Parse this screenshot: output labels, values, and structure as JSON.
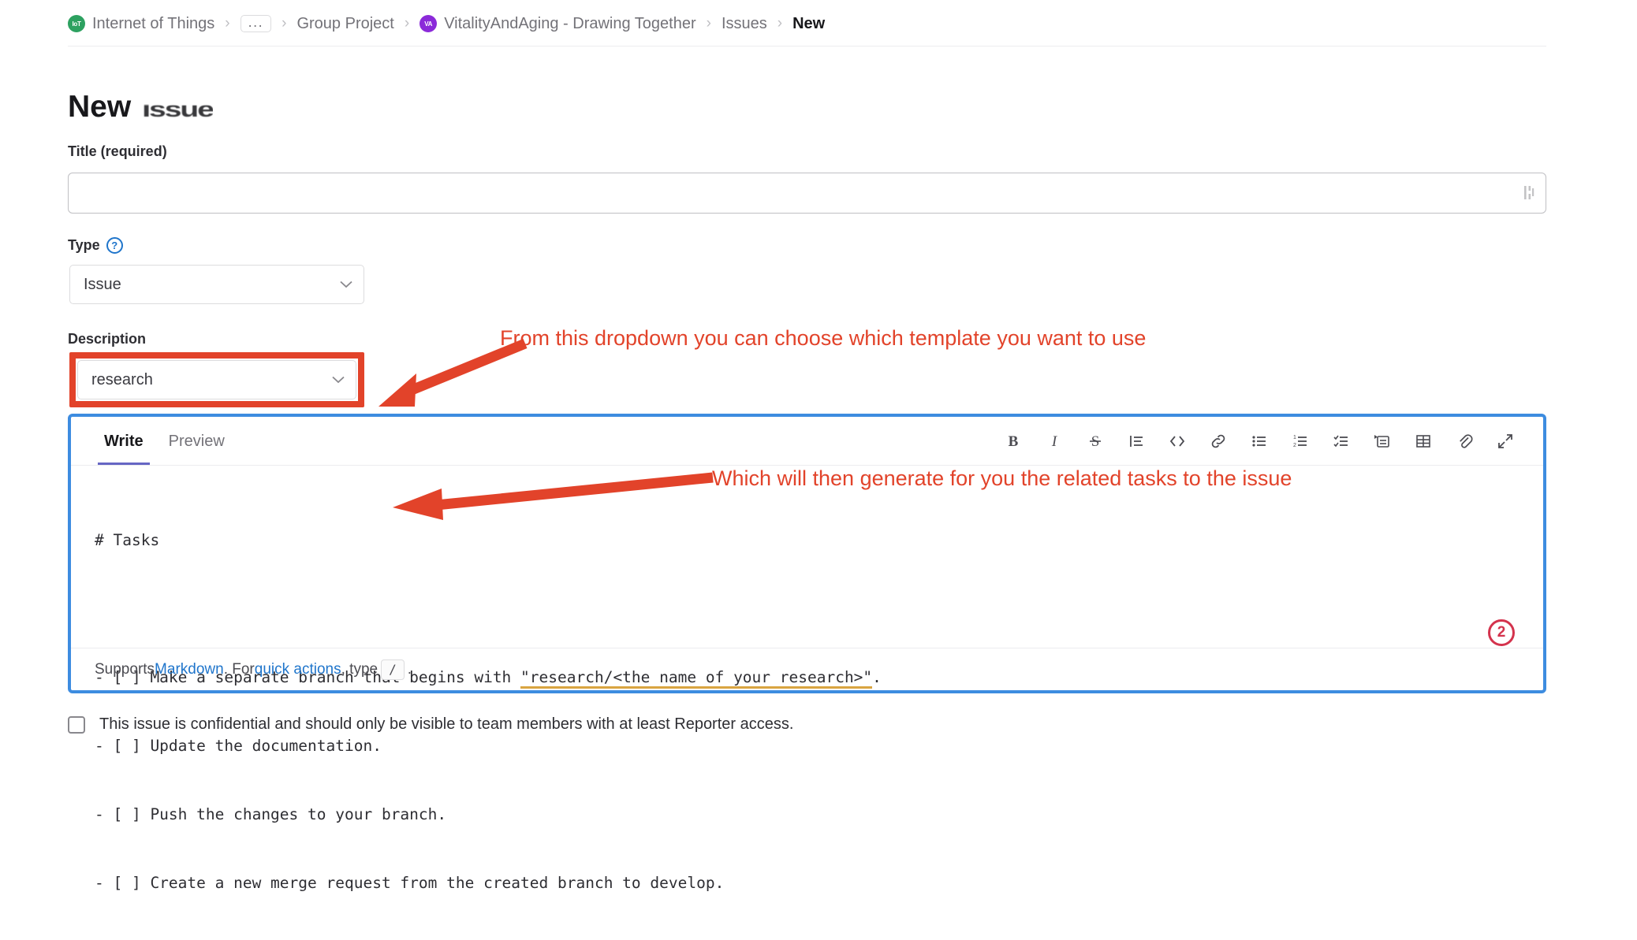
{
  "breadcrumb": {
    "items": [
      {
        "label": "Internet of Things",
        "avatar": "IoT",
        "avatar_color": "#2da160",
        "type": "group"
      },
      {
        "label": "...",
        "type": "ellipsis"
      },
      {
        "label": "Group Project",
        "type": "plain"
      },
      {
        "label": "VitalityAndAging - Drawing Together",
        "avatar": "VA",
        "avatar_color": "#8b2ad9",
        "type": "project"
      },
      {
        "label": "Issues",
        "type": "plain"
      },
      {
        "label": "New",
        "type": "current"
      }
    ],
    "separator": "›"
  },
  "page": {
    "title_prefix": "New",
    "title_glitch_word": "Issue"
  },
  "form": {
    "title_label": "Title (required)",
    "title_value": "",
    "title_placeholder": "",
    "type_label": "Type",
    "type_help_icon": "question-mark-circle-icon",
    "type_help_glyph": "?",
    "type_value": "Issue",
    "description_label": "Description",
    "template_value": "research",
    "chevron_glyph": "⌄"
  },
  "editor": {
    "tabs": [
      {
        "label": "Write",
        "active": true
      },
      {
        "label": "Preview",
        "active": false
      }
    ],
    "toolbar": [
      {
        "name": "bold-icon",
        "title": "Bold"
      },
      {
        "name": "italic-icon",
        "title": "Italic"
      },
      {
        "name": "strikethrough-icon",
        "title": "Strikethrough"
      },
      {
        "name": "quote-icon",
        "title": "Insert a quote"
      },
      {
        "name": "code-icon",
        "title": "Insert code"
      },
      {
        "name": "link-icon",
        "title": "Add a link"
      },
      {
        "name": "bulleted-list-icon",
        "title": "Add a bullet list"
      },
      {
        "name": "numbered-list-icon",
        "title": "Add a numbered list"
      },
      {
        "name": "task-list-icon",
        "title": "Add a checklist"
      },
      {
        "name": "collapsible-section-icon",
        "title": "Add a collapsible section"
      },
      {
        "name": "table-icon",
        "title": "Add a table"
      },
      {
        "name": "attachment-icon",
        "title": "Attach a file or image"
      },
      {
        "name": "fullscreen-icon",
        "title": "Go full screen"
      }
    ],
    "content": {
      "heading": "# Tasks",
      "lines": [
        "- [ ] Make a separate branch that begins with ",
        "- [ ] Update the documentation.",
        "- [ ] Push the changes to your branch.",
        "- [ ] Create a new merge request from the created branch to develop."
      ],
      "line1_quoted": "\"research/<the name of your research>\"",
      "line1_tail": "."
    },
    "counter_badge": "2",
    "footer": {
      "prefix": "Supports ",
      "markdown_link": "Markdown",
      "middle": ". For ",
      "quick_actions_link": "quick actions",
      "type_text": ", type ",
      "key": "/",
      "suffix": "."
    }
  },
  "confidential": {
    "label": "This issue is confidential and should only be visible to team members with at least Reporter access.",
    "checked": false
  },
  "annotations": [
    {
      "text": "From this dropdown you can choose which template you want to use",
      "color": "#e2432a"
    },
    {
      "text": "Which will then generate for you the related tasks to the issue",
      "color": "#e2432a"
    }
  ],
  "colors": {
    "annotation_red": "#e2432a",
    "highlight_box_red": "#e2432a",
    "editor_focus_blue": "#3d8ce0",
    "link_blue": "#1f75cb",
    "tab_underline": "#6666c4",
    "counter_red": "#d4334d"
  }
}
